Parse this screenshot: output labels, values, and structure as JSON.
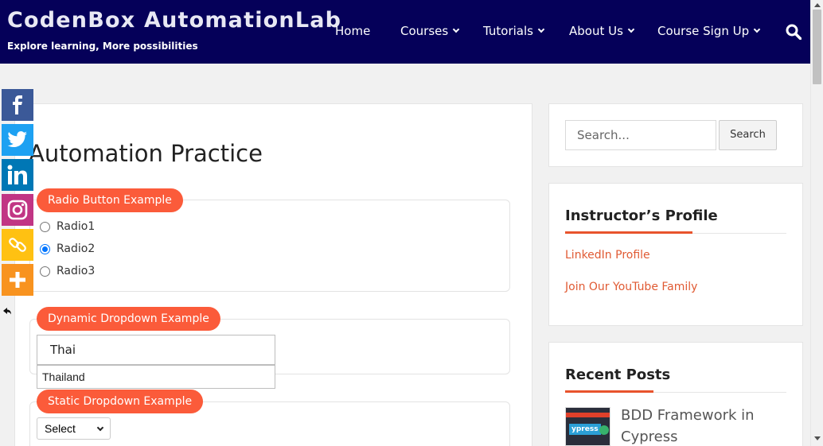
{
  "site": {
    "title": "CodenBox AutomationLab",
    "tagline": "Explore learning, More possibilities"
  },
  "nav": {
    "items": [
      {
        "label": "Home",
        "has_dropdown": false
      },
      {
        "label": "Courses",
        "has_dropdown": true
      },
      {
        "label": "Tutorials",
        "has_dropdown": true
      },
      {
        "label": "About Us",
        "has_dropdown": true
      },
      {
        "label": "Course Sign Up",
        "has_dropdown": true
      }
    ],
    "search_icon": "search-icon"
  },
  "main": {
    "page_title": "Automation Practice",
    "radio_section": {
      "legend": "Radio Button Example",
      "options": [
        {
          "label": "Radio1",
          "checked": false
        },
        {
          "label": "Radio2",
          "checked": true
        },
        {
          "label": "Radio3",
          "checked": false
        }
      ]
    },
    "dynamic_dropdown": {
      "legend": "Dynamic Dropdown Example",
      "input_value": "Thai",
      "suggestions": [
        "Thailand"
      ]
    },
    "static_dropdown": {
      "legend": "Static Dropdown Example",
      "selected": "Select"
    }
  },
  "social_bar": {
    "items": [
      {
        "icon": "facebook-icon",
        "color": "#3b5998"
      },
      {
        "icon": "twitter-icon",
        "color": "#1da1f2"
      },
      {
        "icon": "linkedin-icon",
        "color": "#0077b5"
      },
      {
        "icon": "instagram-icon",
        "color": "#c13584"
      },
      {
        "icon": "copy-link-icon",
        "color": "#ffc112"
      },
      {
        "icon": "more-icon",
        "color": "#f8931f"
      }
    ]
  },
  "sidebar": {
    "search": {
      "placeholder": "Search...",
      "button_label": "Search"
    },
    "instructor": {
      "title": "Instructor’s Profile",
      "links": [
        "LinkedIn Profile",
        "Join Our YouTube Family"
      ]
    },
    "recent_posts": {
      "title": "Recent Posts",
      "posts": [
        {
          "title": "BDD Framework in Cypress",
          "thumb_text": "ypress"
        }
      ]
    }
  },
  "colors": {
    "header_bg": "#050059",
    "accent": "#fb5b3a",
    "link": "#e05a33"
  }
}
